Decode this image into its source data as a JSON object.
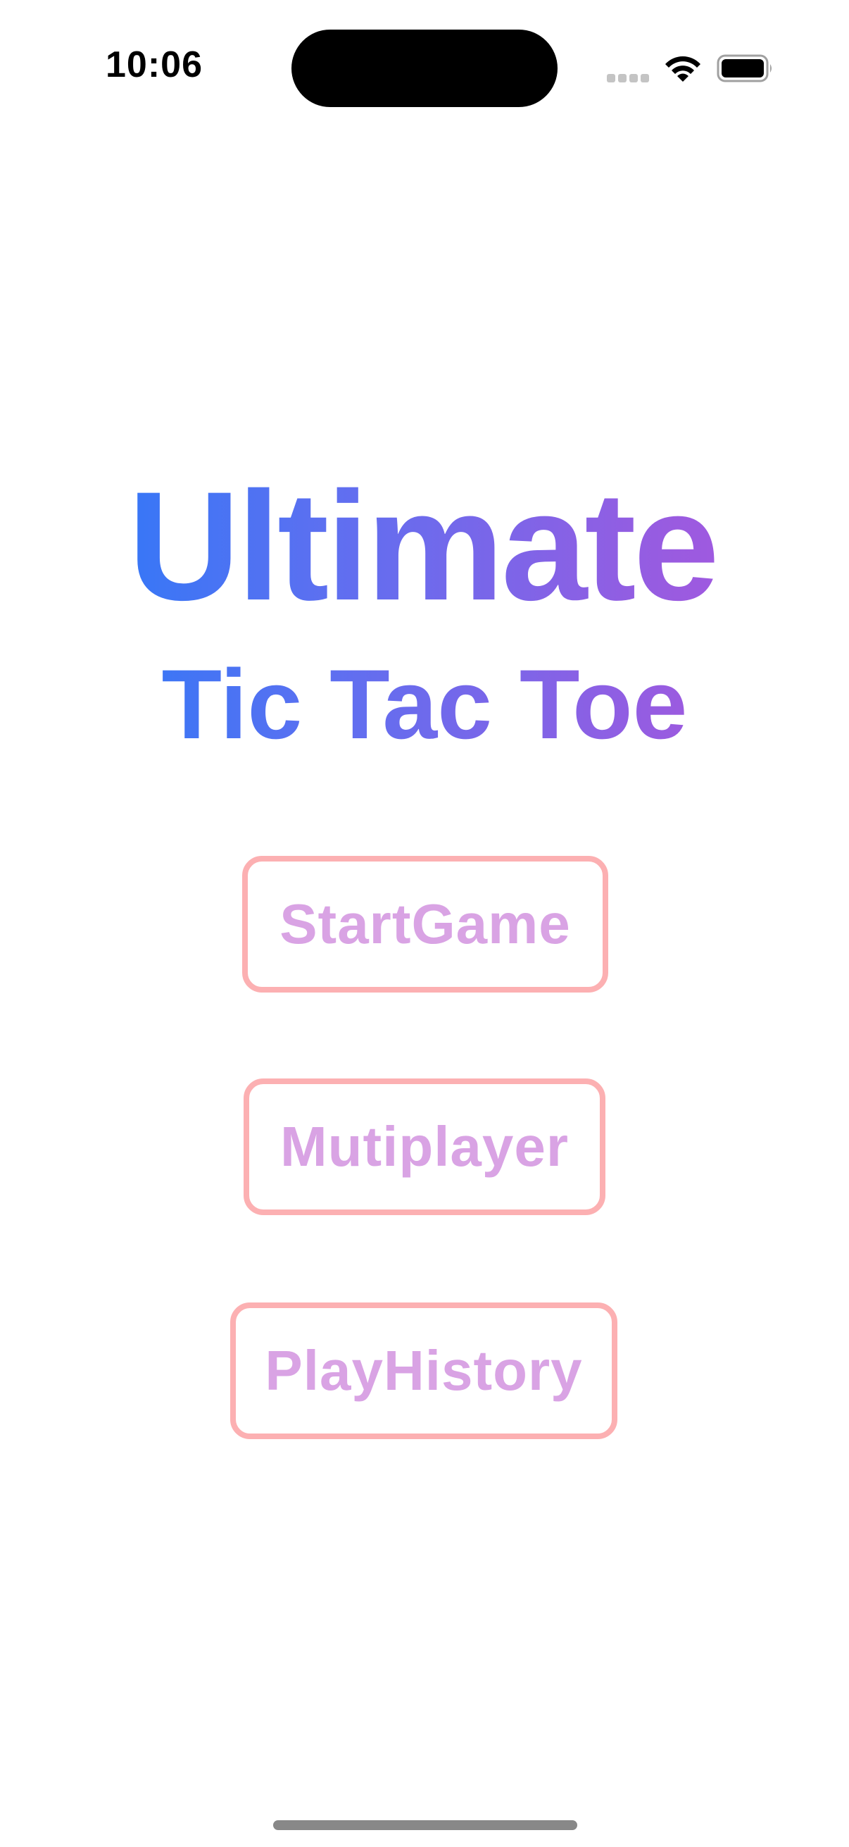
{
  "status_bar": {
    "time": "10:06",
    "icons": [
      "cellular-signal-icon",
      "wifi-icon",
      "battery-icon"
    ]
  },
  "title": {
    "line1": "Ultimate",
    "line2": "Tic Tac Toe",
    "gradient_start": "#1f7cfa",
    "gradient_end": "#ad55df"
  },
  "menu": {
    "buttons": [
      {
        "label": "StartGame"
      },
      {
        "label": "Mutiplayer"
      },
      {
        "label": "PlayHistory"
      }
    ],
    "border_color": "#fcb0b2",
    "text_color": "#d9a3e4"
  }
}
